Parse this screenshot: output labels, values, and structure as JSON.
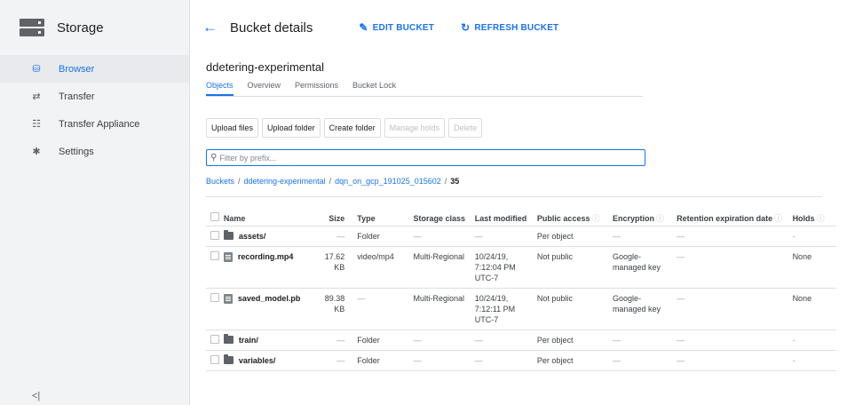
{
  "sidebar": {
    "title": "Storage",
    "items": [
      {
        "label": "Browser",
        "icon": "bucket-icon",
        "glyph": "⛁"
      },
      {
        "label": "Transfer",
        "icon": "transfer-icon",
        "glyph": "⇄"
      },
      {
        "label": "Transfer Appliance",
        "icon": "appliance-icon",
        "glyph": "☷"
      },
      {
        "label": "Settings",
        "icon": "gear-icon",
        "glyph": "✱"
      }
    ],
    "collapse": "<|"
  },
  "header": {
    "title": "Bucket details",
    "edit_label": "EDIT BUCKET",
    "refresh_label": "REFRESH BUCKET"
  },
  "bucket": {
    "name": "ddetering-experimental",
    "tabs": [
      "Objects",
      "Overview",
      "Permissions",
      "Bucket Lock"
    ]
  },
  "actions": {
    "upload_files": "Upload files",
    "upload_folder": "Upload folder",
    "create_folder": "Create folder",
    "manage_holds": "Manage holds",
    "delete": "Delete"
  },
  "filter": {
    "placeholder": "Filter by prefix..."
  },
  "breadcrumb": {
    "root": "Buckets",
    "bucket": "ddetering-experimental",
    "folder": "dqn_on_gcp_191025_015602",
    "current": "35",
    "sep": "/"
  },
  "table": {
    "headers": {
      "name": "Name",
      "size": "Size",
      "type": "Type",
      "storage_class": "Storage class",
      "last_modified": "Last modified",
      "public_access": "Public access",
      "encryption": "Encryption",
      "retention": "Retention expiration date",
      "holds": "Holds"
    },
    "rows": [
      {
        "name": "assets/",
        "kind": "folder",
        "size": "—",
        "type": "Folder",
        "storage_class": "—",
        "last_modified": "—",
        "public_access": "Per object",
        "encryption": "—",
        "retention": "—",
        "holds": "-"
      },
      {
        "name": "recording.mp4",
        "kind": "file",
        "size": "17.62 KB",
        "type": "video/mp4",
        "storage_class": "Multi-Regional",
        "last_modified": "10/24/19, 7:12:04 PM UTC-7",
        "public_access": "Not public",
        "encryption": "Google-managed key",
        "retention": "—",
        "holds": "None"
      },
      {
        "name": "saved_model.pb",
        "kind": "file",
        "size": "89.38 KB",
        "type": "—",
        "storage_class": "Multi-Regional",
        "last_modified": "10/24/19, 7:12:11 PM UTC-7",
        "public_access": "Not public",
        "encryption": "Google-managed key",
        "retention": "—",
        "holds": "None"
      },
      {
        "name": "train/",
        "kind": "folder",
        "size": "—",
        "type": "Folder",
        "storage_class": "—",
        "last_modified": "—",
        "public_access": "Per object",
        "encryption": "—",
        "retention": "—",
        "holds": "-"
      },
      {
        "name": "variables/",
        "kind": "folder",
        "size": "—",
        "type": "Folder",
        "storage_class": "—",
        "last_modified": "—",
        "public_access": "Per object",
        "encryption": "—",
        "retention": "—",
        "holds": "-"
      }
    ]
  }
}
